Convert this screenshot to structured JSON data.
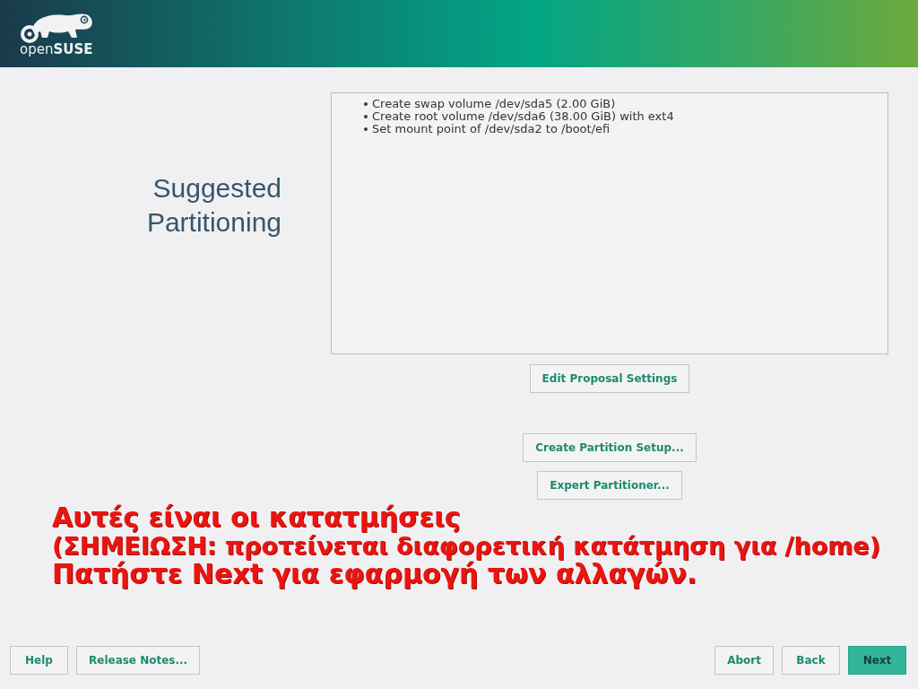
{
  "header": {
    "logo_text": "open**SUSE**"
  },
  "title": "Suggested Partitioning",
  "proposal_summary": {
    "items": [
      "Create swap volume /dev/sda5 (2.00 GiB)",
      "Create root volume /dev/sda6 (38.00 GiB) with ext4",
      "Set mount point of /dev/sda2 to /boot/efi"
    ]
  },
  "proposal_actions": {
    "edit_button": "Edit Proposal Settings",
    "setup_buttons": [
      "Create Partition Setup...",
      "Expert Partitioner..."
    ]
  },
  "annotation": {
    "title": "Αυτές είναι οι κατατμήσεις",
    "note": "(ΣΗΜΕΙΩΣΗ: προτείνεται διαφορετική κατάτμηση για /home)",
    "instruction": "Πατήστε Next για εφαρμογή των αλλαγών."
  },
  "footer": {
    "left_buttons": [
      {
        "label": "Help",
        "primary": false
      },
      {
        "label": "Release Notes...",
        "primary": false
      }
    ],
    "right_buttons": [
      {
        "label": "Abort",
        "primary": false
      },
      {
        "label": "Back",
        "primary": false
      },
      {
        "label": "Next",
        "primary": true
      }
    ]
  }
}
